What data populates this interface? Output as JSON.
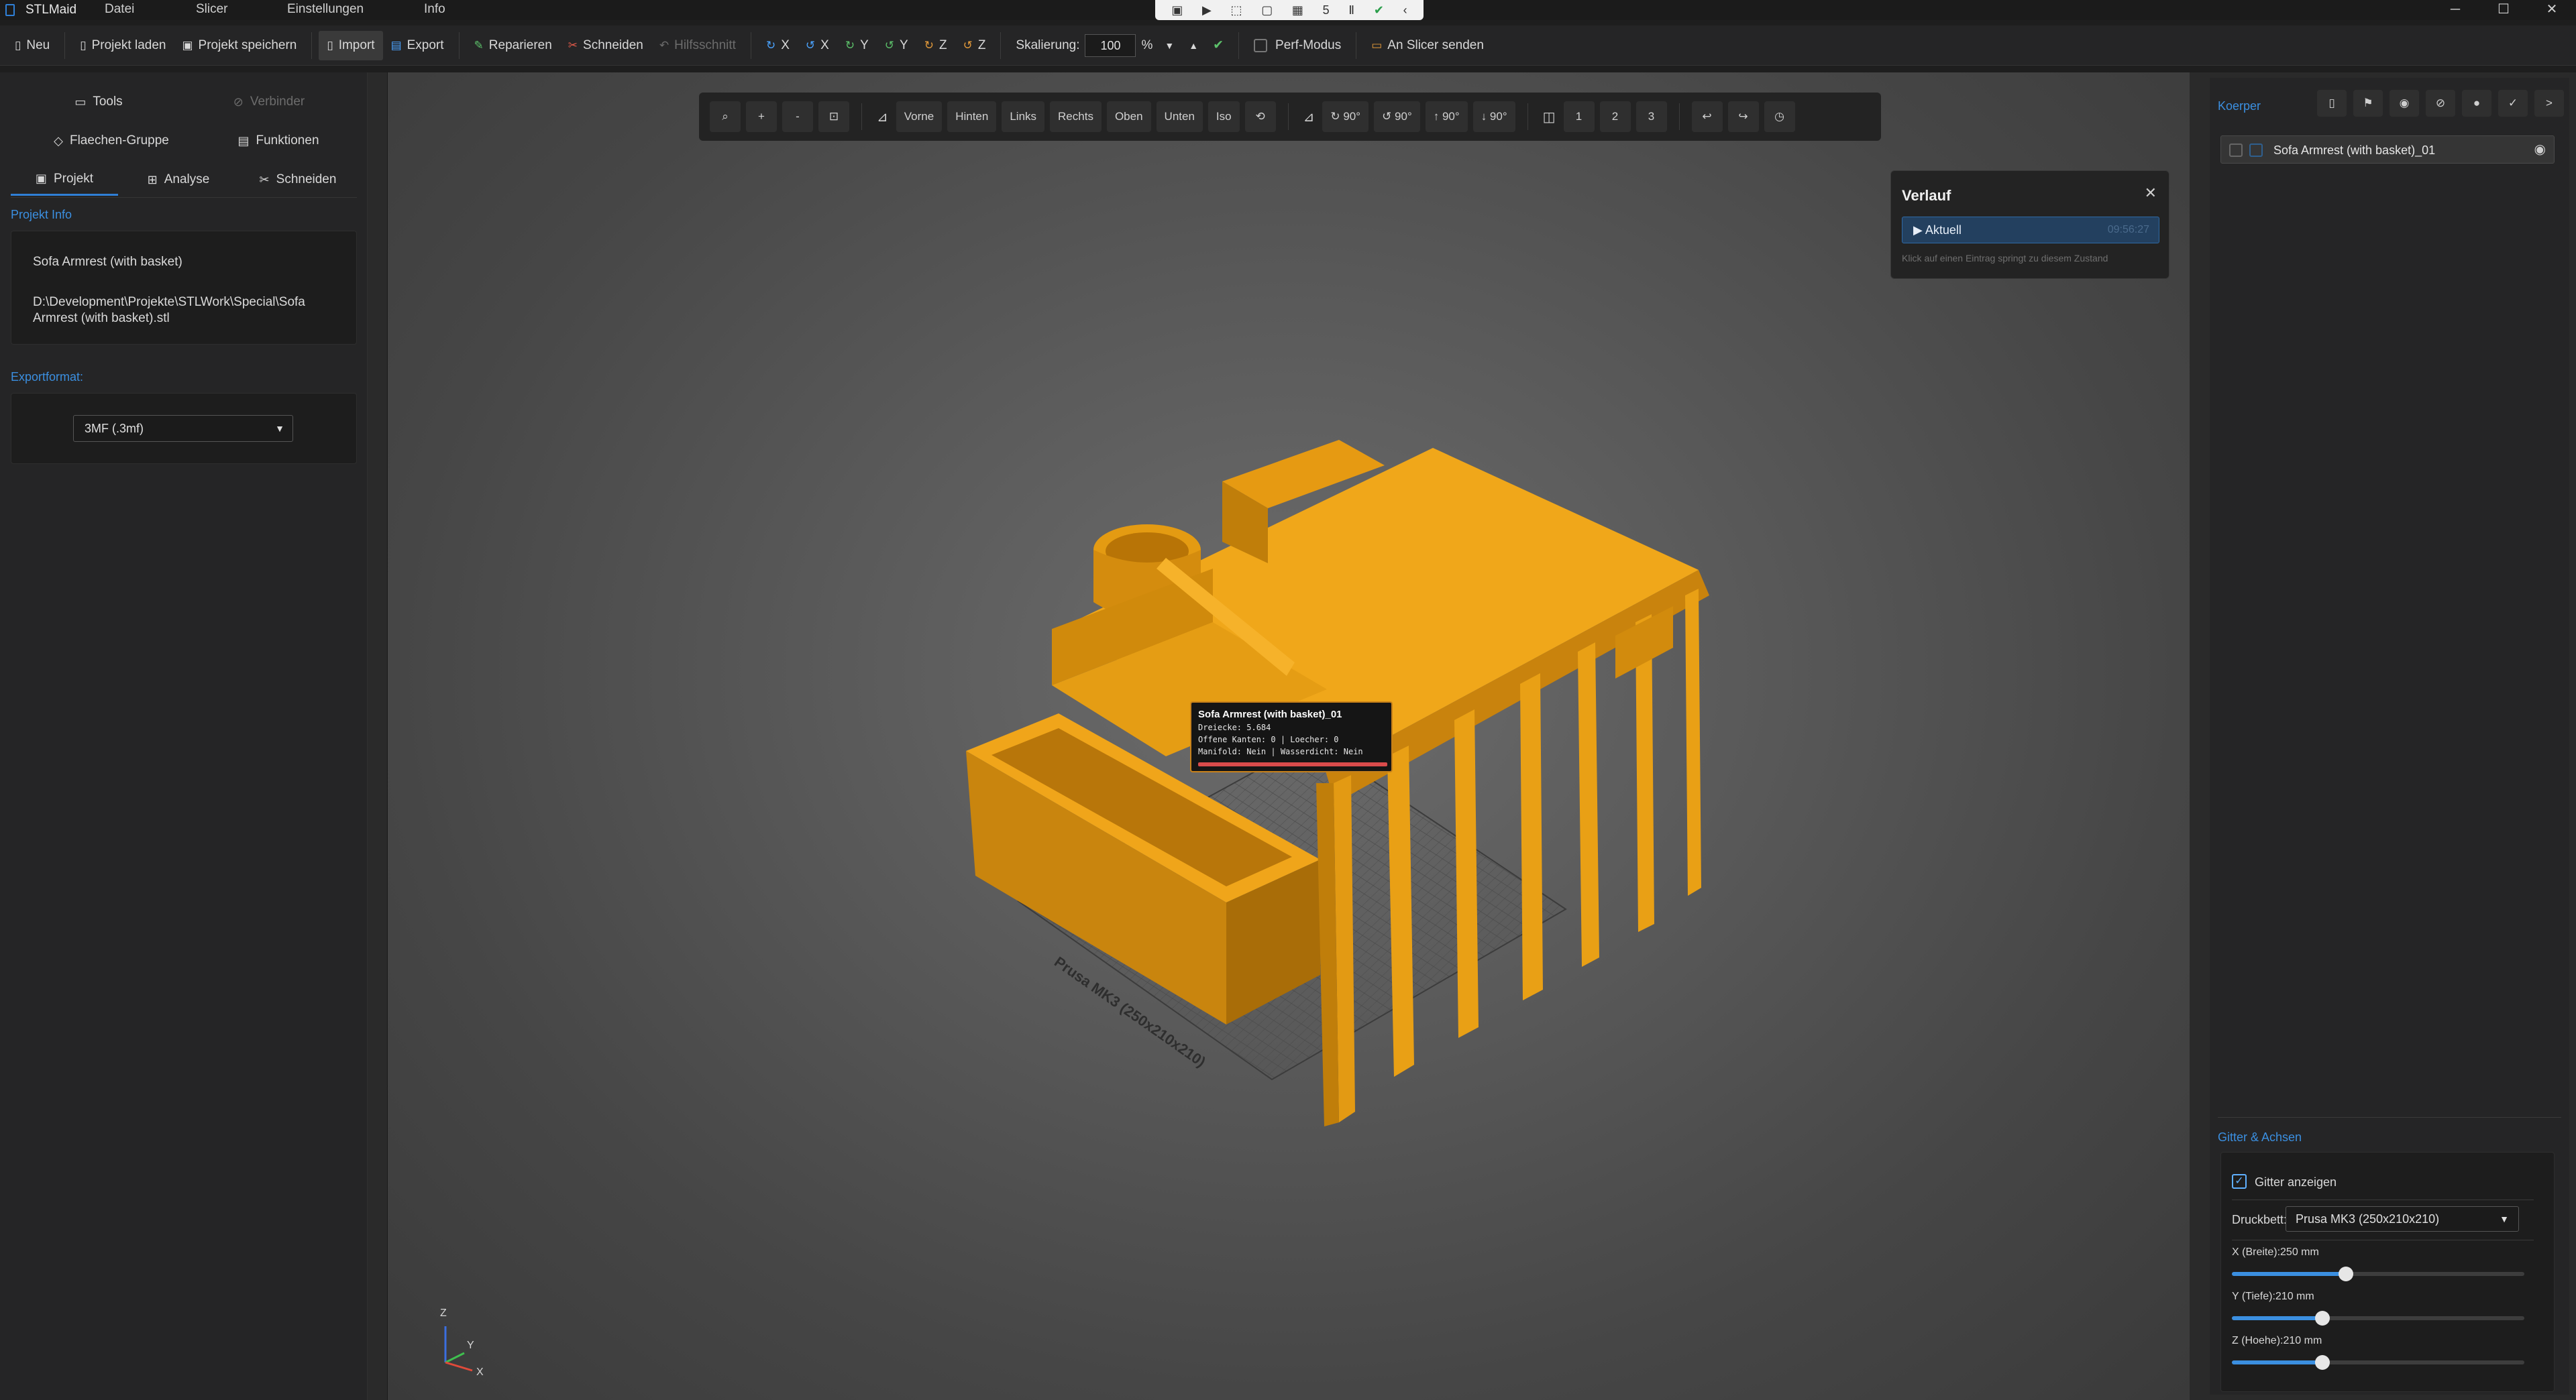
{
  "titlebar": {
    "app_name": "STLMaid",
    "menus": [
      "Datei",
      "Slicer",
      "Einstellungen",
      "Info"
    ],
    "recording_count": "5"
  },
  "toolbar": {
    "neu": "Neu",
    "projekt_laden": "Projekt laden",
    "projekt_speichern": "Projekt speichern",
    "import": "Import",
    "export": "Export",
    "reparieren": "Reparieren",
    "schneiden": "Schneiden",
    "hilfsschnitt": "Hilfsschnitt",
    "rot_x1": "X",
    "rot_x2": "X",
    "rot_y1": "Y",
    "rot_y2": "Y",
    "rot_z1": "Z",
    "rot_z2": "Z",
    "skalierung_label": "Skalierung:",
    "skalierung_value": "100",
    "percent": "%",
    "perf_modus": "Perf-Modus",
    "an_slicer": "An Slicer senden"
  },
  "left": {
    "tabs_row1": {
      "tools": "Tools",
      "verbinder": "Verbinder"
    },
    "tabs_row2": {
      "flaechen": "Flaechen-Gruppe",
      "funktionen": "Funktionen"
    },
    "tabs_row3": {
      "projekt": "Projekt",
      "analyse": "Analyse",
      "schneiden": "Schneiden"
    },
    "projekt_info_label": "Projekt Info",
    "project_name": "Sofa Armrest (with basket)",
    "project_path_line1": "D:\\Development\\Projekte\\STLWork\\Special\\Sofa",
    "project_path_line2": "Armrest (with basket).stl",
    "exportformat_label": "Exportformat:",
    "exportformat_value": "3MF (.3mf)"
  },
  "viewport": {
    "view_buttons": {
      "vorne": "Vorne",
      "hinten": "Hinten",
      "links": "Links",
      "rechts": "Rechts",
      "oben": "Oben",
      "unten": "Unten",
      "iso": "Iso",
      "rot1": "↻ 90°",
      "rot2": "↺ 90°",
      "rot3": "↑ 90°",
      "rot4": "↓ 90°",
      "cam1": "1",
      "cam2": "2",
      "cam3": "3",
      "plus": "+",
      "minus": "-"
    },
    "bed_label": "Prusa MK3 (250x210x210)",
    "tooltip": {
      "title": "Sofa Armrest (with basket)_01",
      "line1": "Dreiecke: 5.684",
      "line2": "Offene Kanten: 0 | Loecher: 0",
      "line3": "Manifold: Nein | Wasserdicht: Nein"
    },
    "axes": {
      "z": "Z",
      "y": "Y",
      "x": "X"
    },
    "model_color": "#e39510"
  },
  "verlauf": {
    "title": "Verlauf",
    "entry_label": "Aktuell",
    "entry_time": "09:56:27",
    "hint": "Klick auf einen Eintrag springt zu diesem Zustand"
  },
  "right": {
    "koerper_label": "Koerper",
    "body_name": "Sofa Armrest (with basket)_01",
    "gitter_label": "Gitter & Achsen",
    "gitter_anzeigen": "Gitter anzeigen",
    "druckbett_label": "Druckbett:",
    "druckbett_value": "Prusa MK3 (250x210x210)",
    "x_label": "X (Breite):250 mm",
    "y_label": "Y (Tiefe):210 mm",
    "z_label": "Z (Hoehe):210 mm",
    "x_level": 0.39,
    "y_level": 0.31,
    "z_level": 0.31
  },
  "colors": {
    "accent": "#3b8fe0",
    "model": "#e39510",
    "background": "#1e1e1e"
  }
}
